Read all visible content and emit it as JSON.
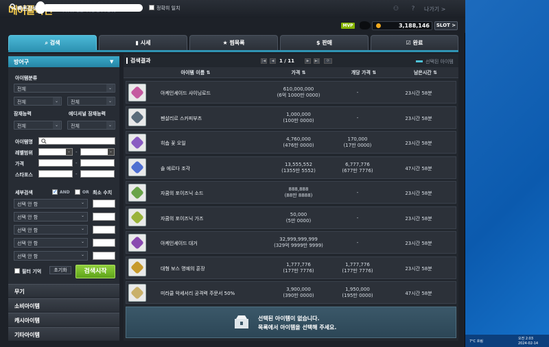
{
  "app": {
    "logo": "메이플옥션",
    "logo_sub": "MAPLE AUCTION",
    "exit": "나가기 >"
  },
  "topbar": {
    "quick_search_label": "빠른검색",
    "quick_search_value": "",
    "exact_match_label": "정확히 일치",
    "mvp": "MVP",
    "meso": "3,188,146",
    "slot": "SLOT >"
  },
  "tabs": [
    {
      "label": "검색"
    },
    {
      "label": "시세"
    },
    {
      "label": "찜목록"
    },
    {
      "label": "판매"
    },
    {
      "label": "완료"
    }
  ],
  "left": {
    "equip": "방어구",
    "item_category_label": "아이템분류",
    "all": "전체",
    "potential_label": "잠재능력",
    "additional_label": "에디셔널 잠재능력",
    "item_name_label": "아이템명",
    "level_label": "레벨범위",
    "price_label": "가격",
    "starforce_label": "스타포스",
    "detail_label": "세부검색",
    "and": "AND",
    "or": "OR",
    "min_label": "최소 수치",
    "opt": "선택 안 함",
    "filter_memory": "필터 기억",
    "reset": "초기화",
    "search": "검색시작",
    "categories": [
      "무기",
      "소비아이템",
      "캐시아이템",
      "기타아이템"
    ]
  },
  "results": {
    "title": "검색결과",
    "page": "1 / 11",
    "selected_label": "선택된 아이템",
    "headers": [
      "아이템 이름",
      "가격",
      "개당 가격",
      "남은시간"
    ],
    "rows": [
      {
        "name": "아케인셰이드 샤이닝로드",
        "price": "610,000,000",
        "price_sub": "(6억 1000만 0000)",
        "unit": "-",
        "unit_sub": "",
        "time": "23시간 58분",
        "icon": "rod-icon"
      },
      {
        "name": "펜살리르 스카피부츠",
        "price": "1,000,000",
        "price_sub": "(100만 0000)",
        "unit": "-",
        "unit_sub": "",
        "time": "23시간 58분",
        "icon": "boots-icon"
      },
      {
        "name": "히솝 꽃 오일",
        "price": "4,760,000",
        "price_sub": "(476만 0000)",
        "unit": "170,000",
        "unit_sub": "(17만 0000)",
        "time": "23시간 58분",
        "icon": "oil-icon"
      },
      {
        "name": "솔 에르다 조각",
        "price": "13,555,552",
        "price_sub": "(1355만 5552)",
        "unit": "6,777,776",
        "unit_sub": "(677만 7776)",
        "time": "47시간 58분",
        "icon": "erda-icon"
      },
      {
        "name": "자쿰의 포이즈닉 소드",
        "price": "888,888",
        "price_sub": "(88만 8888)",
        "unit": "-",
        "unit_sub": "",
        "time": "23시간 58분",
        "icon": "sword-icon"
      },
      {
        "name": "자쿰의 포이즈닉 가즈",
        "price": "50,000",
        "price_sub": "(5만 0000)",
        "unit": "-",
        "unit_sub": "",
        "time": "23시간 58분",
        "icon": "gaze-icon"
      },
      {
        "name": "아케인셰이드 대거",
        "price": "32,999,999,999",
        "price_sub": "(329억 9999만 9999)",
        "unit": "-",
        "unit_sub": "",
        "time": "23시간 58분",
        "icon": "dagger-icon"
      },
      {
        "name": "대형 보스 명예의 훈장",
        "price": "1,777,776",
        "price_sub": "(177만 7776)",
        "unit": "1,777,776",
        "unit_sub": "(177만 7776)",
        "time": "23시간 58분",
        "icon": "medal-icon"
      },
      {
        "name": "미라클 악세서리 공격력 주문서 50%",
        "price": "3,900,000",
        "price_sub": "(390만 0000)",
        "unit": "1,950,000",
        "unit_sub": "(195만 0000)",
        "time": "47시간 58분",
        "icon": "scroll-icon"
      }
    ],
    "empty_line1": "선택된 아이템이 없습니다.",
    "empty_line2": "목록에서 아이템을 선택해 주세요."
  },
  "tray": {
    "text": "7°C 흐림",
    "time": "오전 2:03",
    "date": "2024-02-14"
  }
}
